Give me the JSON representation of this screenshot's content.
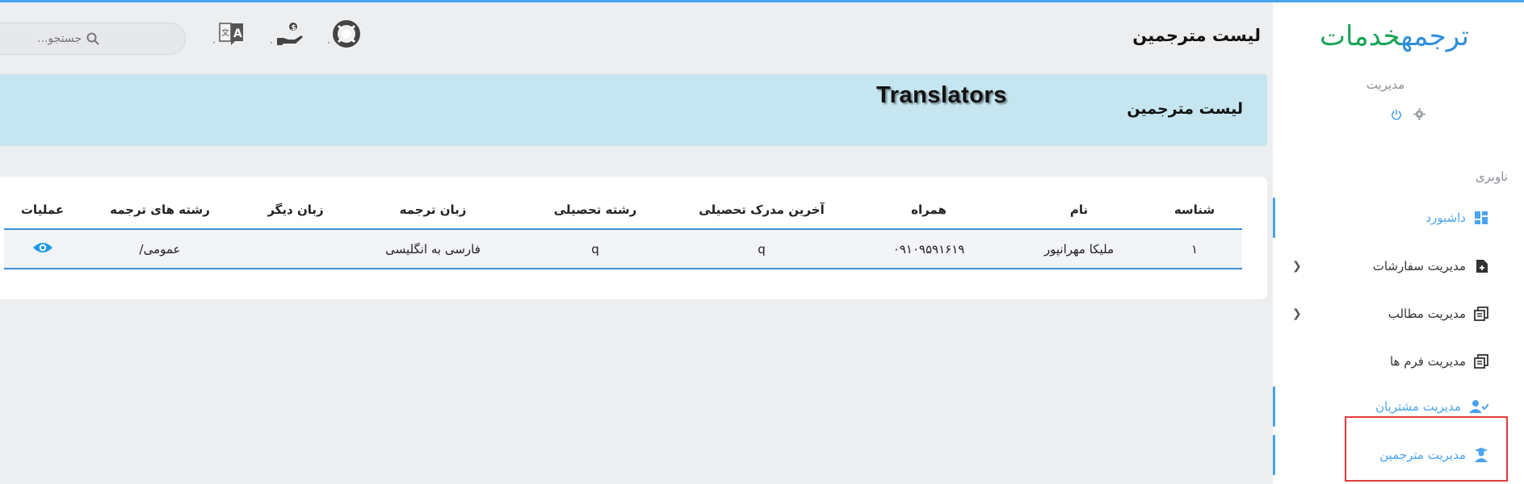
{
  "sidebar": {
    "logo_part1": "خدمات",
    "logo_part2": "ترجمه",
    "user_role": "مدیریت",
    "nav_heading": "ناوبری",
    "items": [
      {
        "label": "داشبورد",
        "icon": "dashboard-icon",
        "active": true
      },
      {
        "label": "مدیریت سفارشات",
        "icon": "document-add-icon",
        "has_submenu": true
      },
      {
        "label": "مدیریت مطالب",
        "icon": "stacked-docs-icon",
        "has_submenu": true
      },
      {
        "label": "مدیریت فرم ها",
        "icon": "stacked-docs-icon"
      },
      {
        "label": "مدیریت مشتریان",
        "icon": "user-check-icon",
        "active": true
      },
      {
        "label": "مدیریت مترجمین",
        "icon": "user-graduate-icon",
        "active": true
      }
    ]
  },
  "header": {
    "page_title": "لیست مترجمین",
    "search_placeholder": "جستجو...",
    "icon_badges": [
      "۰",
      "۰",
      "۰"
    ]
  },
  "banner": {
    "title": "لیست مترجمین",
    "english_overlay": "Translators"
  },
  "table": {
    "columns": [
      "شناسه",
      "نام",
      "همراه",
      "آخرین مدرک تحصیلی",
      "رشته تحصیلی",
      "زبان ترجمه",
      "زبان دیگر",
      "رشته های ترجمه",
      "عملیات"
    ],
    "rows": [
      {
        "id": "۱",
        "name": "ملیکا مهرانپور",
        "phone": "۰۹۱۰۹۵۹۱۶۱۹",
        "degree": "q",
        "field": "q",
        "translation_lang": "فارسی به انگلیسی",
        "other_lang": "",
        "translation_fields": "عمومی/"
      }
    ]
  },
  "colors": {
    "accent": "#4aa3f0",
    "banner": "#c5e6f0",
    "logo_green": "#18a558",
    "logo_blue": "#2f8fd9",
    "highlight": "#e23b3b"
  }
}
